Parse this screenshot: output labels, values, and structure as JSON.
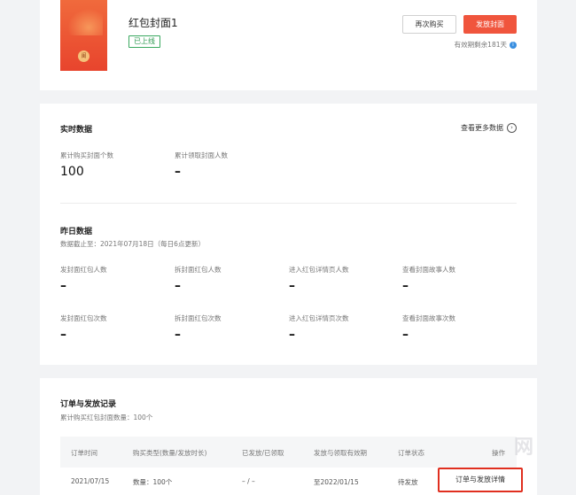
{
  "cover": {
    "name": "红包封面1",
    "status": "已上线",
    "seal_char": "闺",
    "rebuy_label": "再次购买",
    "issue_label": "发放封面",
    "validity": "有效期剩余181天"
  },
  "realtime": {
    "title": "实时数据",
    "more_label": "查看更多数据",
    "stats": [
      {
        "label": "累计购买封面个数",
        "value": "100"
      },
      {
        "label": "累计领取封面人数",
        "value": "–"
      }
    ]
  },
  "yesterday": {
    "title": "昨日数据",
    "note": "数据截止至：2021年07月18日（每日6点更新）",
    "row1": [
      {
        "label": "发封面红包人数",
        "value": "–"
      },
      {
        "label": "拆封面红包人数",
        "value": "–"
      },
      {
        "label": "进入红包详情页人数",
        "value": "–"
      },
      {
        "label": "查看封面故事人数",
        "value": "–"
      }
    ],
    "row2": [
      {
        "label": "发封面红包次数",
        "value": "–"
      },
      {
        "label": "拆封面红包次数",
        "value": "–"
      },
      {
        "label": "进入红包详情页次数",
        "value": "–"
      },
      {
        "label": "查看封面故事次数",
        "value": "–"
      }
    ]
  },
  "orders": {
    "title": "订单与发放记录",
    "summary": "累计购买红包封面数量：100个",
    "columns": [
      "订单时间",
      "购买类型(数量/发放时长)",
      "已发放/已领取",
      "发放与领取有效期",
      "订单状态",
      "操作"
    ],
    "row": {
      "time": "2021/07/15",
      "type": "数量：100个",
      "issued": "– / –",
      "period": "至2022/01/15",
      "status": "待发放",
      "action": "订单与发放详情"
    }
  },
  "watermark": "网"
}
